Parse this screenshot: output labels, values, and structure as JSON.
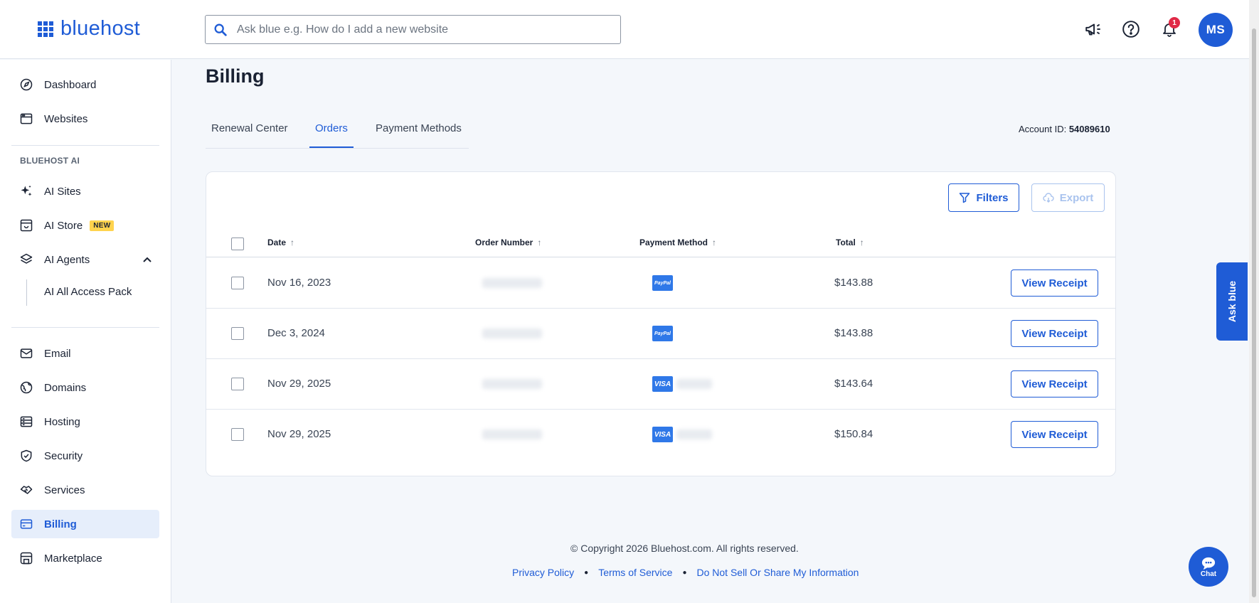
{
  "header": {
    "logo_text": "bluehost",
    "search_placeholder": "Ask blue e.g. How do I add a new website",
    "notification_count": "1",
    "avatar_initials": "MS"
  },
  "sidebar": {
    "top_items": [
      {
        "label": "Dashboard",
        "icon": "dashboard-icon"
      },
      {
        "label": "Websites",
        "icon": "browser-icon"
      }
    ],
    "section_title": "BLUEHOST AI",
    "ai_items": [
      {
        "label": "AI Sites",
        "icon": "sparkle-icon"
      },
      {
        "label": "AI Store",
        "icon": "store-icon",
        "tag": "NEW"
      },
      {
        "label": "AI Agents",
        "icon": "layers-icon"
      }
    ],
    "ai_sub_item": "AI All Access Pack",
    "bottom_items": [
      {
        "label": "Email",
        "icon": "mail-icon"
      },
      {
        "label": "Domains",
        "icon": "globe-icon"
      },
      {
        "label": "Hosting",
        "icon": "server-icon"
      },
      {
        "label": "Security",
        "icon": "shield-icon"
      },
      {
        "label": "Services",
        "icon": "handshake-icon"
      },
      {
        "label": "Billing",
        "icon": "credit-card-icon",
        "active": true
      },
      {
        "label": "Marketplace",
        "icon": "marketplace-icon"
      }
    ]
  },
  "main": {
    "title": "Billing",
    "tabs": [
      {
        "label": "Renewal Center"
      },
      {
        "label": "Orders",
        "active": true
      },
      {
        "label": "Payment Methods"
      }
    ],
    "account_id_label": "Account ID:",
    "account_id_value": "54089610",
    "filters_label": "Filters",
    "export_label": "Export",
    "columns": {
      "date": "Date",
      "order_number": "Order Number",
      "payment_method": "Payment Method",
      "total": "Total"
    },
    "rows": [
      {
        "date": "Nov 16, 2023",
        "payment": "PayPal",
        "total": "$143.88",
        "action": "View Receipt"
      },
      {
        "date": "Dec 3, 2024",
        "payment": "PayPal",
        "total": "$143.88",
        "action": "View Receipt"
      },
      {
        "date": "Nov 29, 2025",
        "payment": "VISA",
        "total": "$143.64",
        "action": "View Receipt"
      },
      {
        "date": "Nov 29, 2025",
        "payment": "VISA",
        "total": "$150.84",
        "action": "View Receipt"
      }
    ]
  },
  "footer": {
    "copyright": "© Copyright 2026 Bluehost.com. All rights reserved.",
    "links": [
      "Privacy Policy",
      "Terms of Service",
      "Do Not Sell Or Share My Information"
    ]
  },
  "floating": {
    "ask_blue": "Ask blue",
    "chat": "Chat"
  },
  "colors": {
    "brand": "#1f5cd6",
    "badge": "#e02947",
    "new_tag": "#ffd34e",
    "active_bg": "#e6eefb"
  }
}
